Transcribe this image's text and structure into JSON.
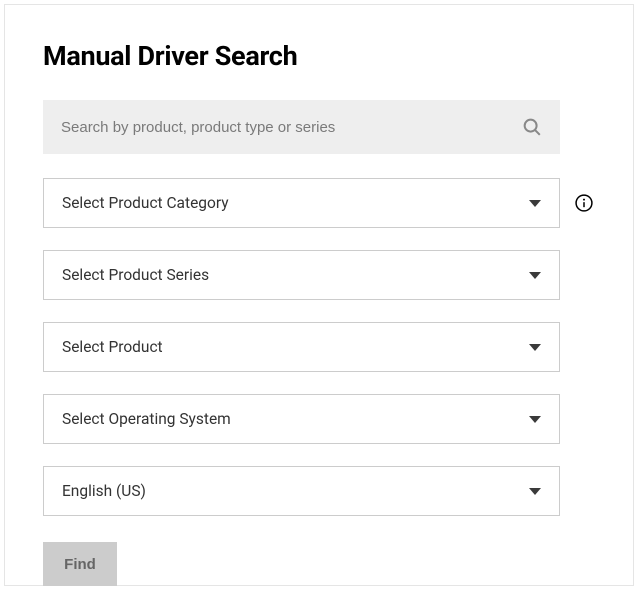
{
  "title": "Manual Driver Search",
  "search": {
    "placeholder": "Search by product, product type or series",
    "value": ""
  },
  "dropdowns": {
    "product_category": "Select Product Category",
    "product_series": "Select Product Series",
    "product": "Select Product",
    "operating_system": "Select Operating System",
    "language": "English (US)"
  },
  "find_button": "Find"
}
